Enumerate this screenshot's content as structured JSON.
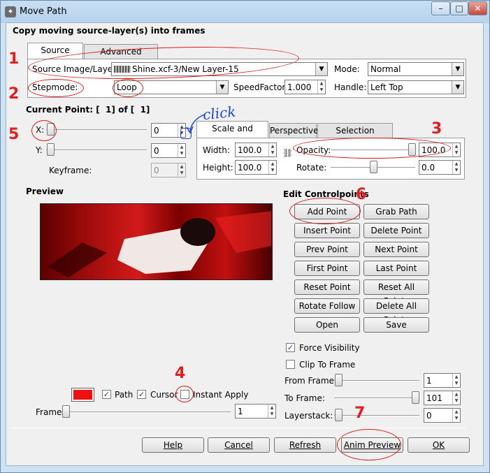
{
  "window": {
    "title": "Move Path",
    "app_icon": "gimp-icon",
    "minimize": "–",
    "maximize": "□",
    "close": "✕"
  },
  "header": "Copy moving source-layer(s) into frames",
  "top_tabs": [
    "Source Select",
    "Advanced Settings"
  ],
  "source": {
    "image_layer_label": "Source Image/Layer:",
    "image_layer_value": "Shine.xcf-3/New Layer-15",
    "mode_label": "Mode:",
    "mode_value": "Normal",
    "stepmode_label": "Stepmode:",
    "stepmode_value": "Loop",
    "speedfactor_label": "SpeedFactor:",
    "speedfactor_value": "1.000",
    "handle_label": "Handle:",
    "handle_value": "Left  Top"
  },
  "current_point": {
    "prefix": "Current Point: [",
    "index": "1",
    "mid": "] of [",
    "total": "1",
    "suffix": "]"
  },
  "coords": {
    "x_label": "X:",
    "x_value": "0",
    "y_label": "Y:",
    "y_value": "0",
    "keyframe_label": "Keyframe:",
    "keyframe_value": "0"
  },
  "sub_tabs": [
    "Scale and Modify",
    "Perspective",
    "Selection Handling"
  ],
  "scale": {
    "width_label": "Width:",
    "width_value": "100.0",
    "height_label": "Height:",
    "height_value": "100.0",
    "opacity_label": "Opacity:",
    "opacity_value": "100.0",
    "rotate_label": "Rotate:",
    "rotate_value": "0.0"
  },
  "preview_label": "Preview",
  "edit_label": "Edit Controlpoints",
  "edit_buttons": [
    [
      "Add Point",
      "Grab Path"
    ],
    [
      "Insert Point",
      "Delete Point"
    ],
    [
      "Prev Point",
      "Next Point"
    ],
    [
      "First Point",
      "Last Point"
    ],
    [
      "Reset Point",
      "Reset All Points"
    ],
    [
      "Rotate Follow",
      "Delete All Points"
    ],
    [
      "Open",
      "Save"
    ]
  ],
  "options": {
    "force_visibility": "Force Visibility",
    "clip_to_frame": "Clip To Frame",
    "from_frame_label": "From Frame:",
    "from_frame_value": "1",
    "to_frame_label": "To Frame:",
    "to_frame_value": "101",
    "layerstack_label": "Layerstack:",
    "layerstack_value": "0"
  },
  "bottom_controls": {
    "path": "Path",
    "cursor": "Cursor",
    "instant_apply": "Instant Apply",
    "frame_label": "Frame:",
    "frame_value": "1",
    "color_swatch": "#ee1111"
  },
  "dialog_buttons": [
    "Help",
    "Cancel",
    "Refresh",
    "Anim Preview",
    "OK"
  ],
  "annotations": {
    "n1": "1",
    "n2": "2",
    "n3": "3",
    "n4": "4",
    "n5": "5",
    "n6": "6",
    "n7": "7",
    "click": "click"
  },
  "colors": {
    "annotation": "#e02020",
    "click_note": "#2244cc"
  }
}
